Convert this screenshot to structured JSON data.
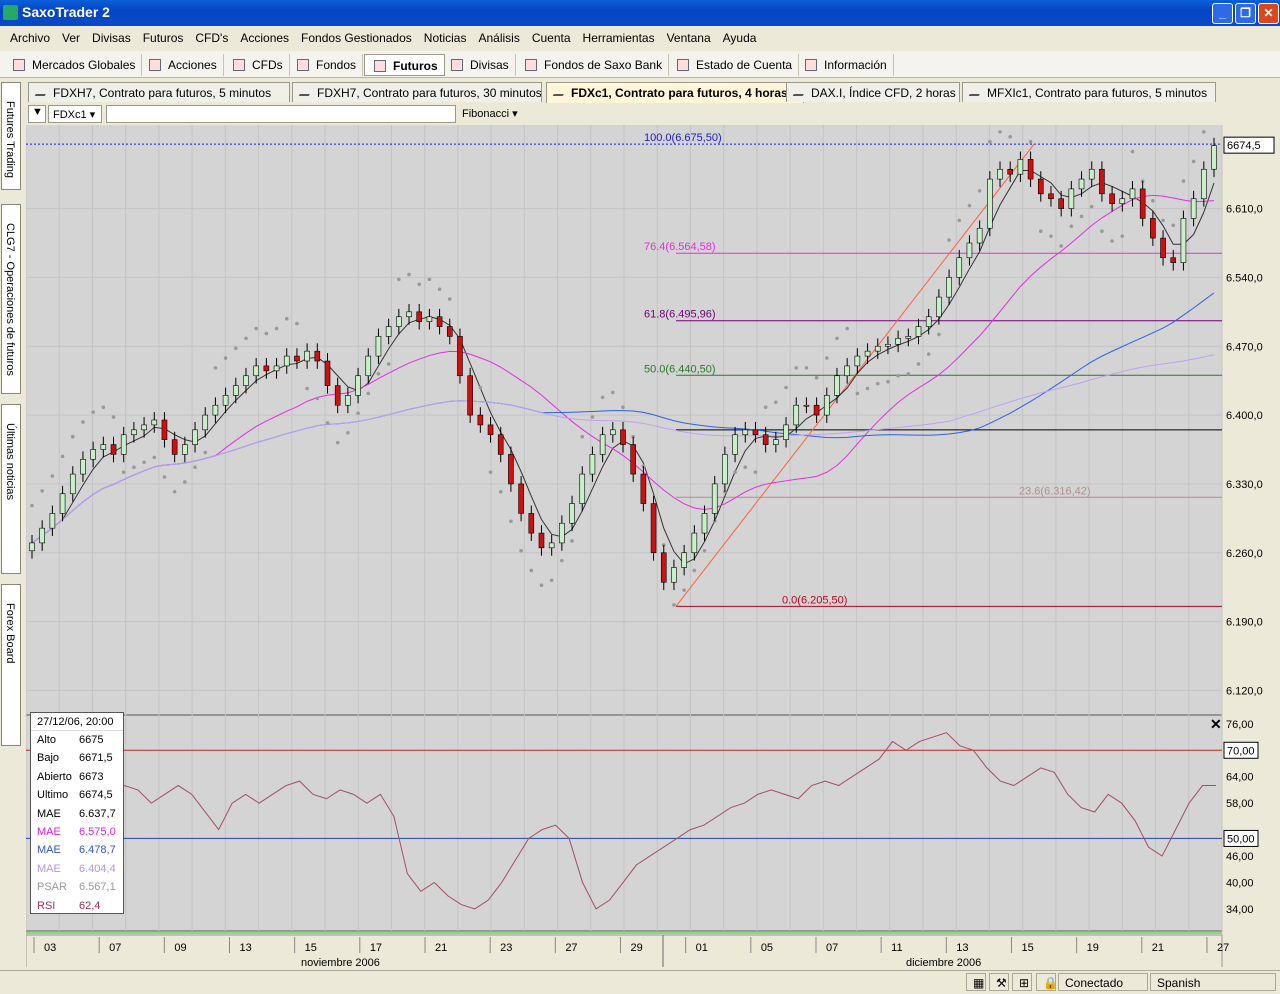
{
  "window": {
    "title": "SaxoTrader 2"
  },
  "menu": [
    "Archivo",
    "Ver",
    "Divisas",
    "Futuros",
    "CFD's",
    "Acciones",
    "Fondos Gestionados",
    "Noticias",
    "Análisis",
    "Cuenta",
    "Herramientas",
    "Ventana",
    "Ayuda"
  ],
  "toolbar": [
    "Mercados Globales",
    "Acciones",
    "CFDs",
    "Fondos",
    "Futuros",
    "Divisas",
    "Fondos de Saxo Bank",
    "Estado de Cuenta",
    "Información"
  ],
  "toolbar_active": "Futuros",
  "tabs": [
    "FDXH7, Contrato para futuros, 5 minutos",
    "FDXH7, Contrato para futuros, 30 minutos",
    "FDXc1, Contrato para futuros, 4 horas",
    "DAX.I, Índice CFD, 2 horas",
    "MFXIc1, Contrato para futuros, 5 minutos"
  ],
  "tab_active": "FDXc1, Contrato para futuros, 4 horas",
  "sidebar": [
    "Futures Trading",
    "CLG7 - Operaciones de futuros",
    "Últimas noticias",
    "Forex Board"
  ],
  "chart_controls": {
    "symbol": "FDXc1",
    "study": "Fibonacci"
  },
  "chart_data": {
    "type": "candlestick",
    "price_axis": [
      "6.610,0",
      "6.540,0",
      "6.470,0",
      "6.400,0",
      "6.330,0",
      "6.260,0",
      "6.190,0",
      "6.120,0"
    ],
    "price_ticks": [
      6610,
      6540,
      6470,
      6400,
      6330,
      6260,
      6190,
      6120
    ],
    "ylim": [
      6095,
      6695
    ],
    "last_price": "6674,5",
    "last_value": 6674.5,
    "fibonacci": [
      {
        "label": "100.0(6.675,50)",
        "value": 6675.5,
        "color": "#1a1ad0"
      },
      {
        "label": "76.4(6.564,58)",
        "value": 6564.58,
        "color": "#e030e0"
      },
      {
        "label": "61.8(6.495,96)",
        "value": 6495.96,
        "color": "#700070"
      },
      {
        "label": "50.0(6.440,50)",
        "value": 6440.5,
        "color": "#2a7a2a"
      },
      {
        "label": "23.6(6.316,42)",
        "value": 6316.42,
        "color": "#b09090"
      },
      {
        "label": "0.0(6.205,50)",
        "value": 6205.5,
        "color": "#c00020"
      }
    ],
    "x_dates": [
      "03",
      "07",
      "09",
      "13",
      "15",
      "17",
      "21",
      "23",
      "27",
      "29",
      "01",
      "05",
      "07",
      "11",
      "13",
      "15",
      "19",
      "21",
      "27"
    ],
    "months": [
      "noviembre 2006",
      "diciembre 2006"
    ],
    "rsi_axis": [
      "76,00",
      "70,00",
      "64,00",
      "58,00",
      "50,00",
      "46,00",
      "40,00",
      "34,00"
    ],
    "rsi_ticks": [
      76,
      70,
      64,
      58,
      50,
      46,
      40,
      34
    ],
    "rsi_levels": [
      {
        "label": "70,00",
        "value": 70
      },
      {
        "label": "50,00",
        "value": 50
      }
    ],
    "rsi_ylim": [
      29,
      78
    ],
    "closes": [
      6270,
      6285,
      6300,
      6320,
      6340,
      6355,
      6365,
      6370,
      6360,
      6380,
      6385,
      6390,
      6395,
      6375,
      6360,
      6370,
      6385,
      6400,
      6410,
      6420,
      6430,
      6440,
      6450,
      6445,
      6450,
      6460,
      6455,
      6465,
      6455,
      6430,
      6410,
      6420,
      6440,
      6460,
      6480,
      6490,
      6500,
      6505,
      6495,
      6500,
      6490,
      6480,
      6440,
      6400,
      6390,
      6380,
      6360,
      6330,
      6300,
      6280,
      6265,
      6270,
      6290,
      6310,
      6340,
      6360,
      6380,
      6385,
      6370,
      6340,
      6310,
      6260,
      6230,
      6245,
      6260,
      6280,
      6300,
      6330,
      6360,
      6380,
      6385,
      6380,
      6370,
      6375,
      6390,
      6410,
      6410,
      6400,
      6420,
      6440,
      6450,
      6460,
      6465,
      6470,
      6472,
      6478,
      6480,
      6490,
      6500,
      6520,
      6540,
      6560,
      6575,
      6590,
      6640,
      6650,
      6645,
      6660,
      6640,
      6625,
      6620,
      6610,
      6630,
      6640,
      6650,
      6625,
      6615,
      6620,
      6630,
      6600,
      6580,
      6560,
      6555,
      6600,
      6620,
      6650,
      6674
    ],
    "rsi": [
      62,
      58,
      60,
      56,
      55,
      52,
      60,
      62,
      61,
      58,
      60,
      62,
      60,
      56,
      52,
      58,
      60,
      58,
      60,
      62,
      63,
      60,
      59,
      61,
      60,
      58,
      60,
      55,
      42,
      38,
      40,
      37,
      35,
      34,
      36,
      40,
      45,
      50,
      52,
      53,
      50,
      40,
      34,
      36,
      40,
      44,
      46,
      48,
      50,
      52,
      53,
      55,
      57,
      58,
      60,
      61,
      60,
      59,
      62,
      63,
      62,
      64,
      66,
      68,
      72,
      70,
      72,
      73,
      74,
      71,
      70,
      66,
      63,
      62,
      64,
      66,
      65,
      60,
      57,
      56,
      60,
      58,
      54,
      48,
      46,
      52,
      58,
      62,
      62
    ]
  },
  "infobox": {
    "date": "27/12/06, 20:00",
    "rows": [
      {
        "k": "Alto",
        "v": "6675",
        "c": "#000"
      },
      {
        "k": "Bajo",
        "v": "6671,5",
        "c": "#000"
      },
      {
        "k": "Abierto",
        "v": "6673",
        "c": "#000"
      },
      {
        "k": "Ultimo",
        "v": "6674,5",
        "c": "#000"
      },
      {
        "k": "MAE",
        "v": "6.637,7",
        "c": "#000"
      },
      {
        "k": "MAE",
        "v": "6.575,0",
        "c": "#e020e0"
      },
      {
        "k": "MAE",
        "v": "6.478,7",
        "c": "#3050e0"
      },
      {
        "k": "MAE",
        "v": "6.404,4",
        "c": "#b890f0"
      },
      {
        "k": "PSAR",
        "v": "6.567,1",
        "c": "#999"
      },
      {
        "k": "RSI",
        "v": "62,4",
        "c": "#a03050"
      }
    ]
  },
  "status": {
    "conn": "Conectado",
    "lang": "Spanish"
  }
}
